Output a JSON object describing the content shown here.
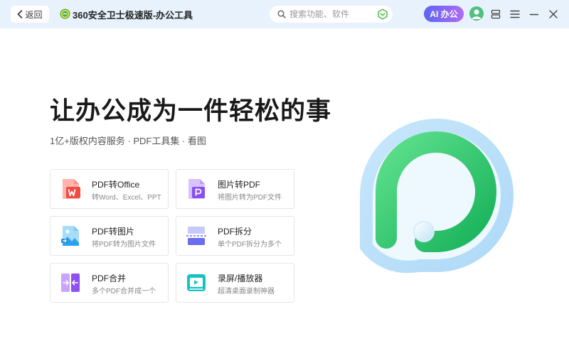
{
  "titlebar": {
    "back_label": "返回",
    "app_title": "360安全卫士极速版-办公工具",
    "search_placeholder": "搜索功能、软件",
    "ai_label": "AI 办公"
  },
  "main": {
    "headline": "让办公成为一件轻松的事",
    "subline": "1亿+版权内容服务 · PDF工具集 · 看图"
  },
  "tools": [
    {
      "title": "PDF转Office",
      "desc": "转Word、Excel、PPT",
      "icon": "pdf-to-office-icon"
    },
    {
      "title": "图片转PDF",
      "desc": "将图片转为PDF文件",
      "icon": "image-to-pdf-icon"
    },
    {
      "title": "PDF转图片",
      "desc": "将PDF转为图片文件",
      "icon": "pdf-to-image-icon"
    },
    {
      "title": "PDF拆分",
      "desc": "单个PDF拆分为多个",
      "icon": "pdf-split-icon"
    },
    {
      "title": "PDF合并",
      "desc": "多个PDF合并成一个",
      "icon": "pdf-merge-icon"
    },
    {
      "title": "录屏/播放器",
      "desc": "超清桌面录制神器",
      "icon": "screen-recorder-icon"
    }
  ],
  "colors": {
    "titlebar_bg": "#e8f2fc",
    "accent_green": "#2fc46a",
    "ai_gradient_start": "#5b66f0",
    "ai_gradient_end": "#b06af5"
  }
}
